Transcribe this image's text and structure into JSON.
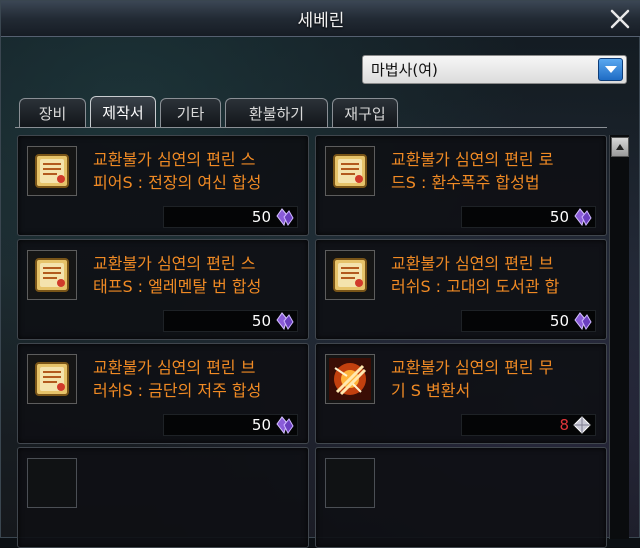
{
  "window": {
    "title": "세베린"
  },
  "class_select": {
    "value": "마법사(여)"
  },
  "tabs": [
    {
      "label": "장비",
      "active": false
    },
    {
      "label": "제작서",
      "active": true
    },
    {
      "label": "기타",
      "active": false
    },
    {
      "label": "환불하기",
      "active": false
    },
    {
      "label": "재구입",
      "active": false
    }
  ],
  "items": [
    {
      "line1": "교환불가 심연의 편린 스",
      "line2": "피어S : 전장의 여신 합성",
      "price": "50",
      "icon": "recipe-scroll-icon"
    },
    {
      "line1": "교환불가 심연의 편린 로",
      "line2": "드S : 환수폭주 합성법",
      "price": "50",
      "icon": "recipe-scroll-icon"
    },
    {
      "line1": "교환불가 심연의 편린 스",
      "line2": "태프S : 엘레멘탈 번 합성",
      "price": "50",
      "icon": "recipe-scroll-icon"
    },
    {
      "line1": "교환불가 심연의 편린 브",
      "line2": "러쉬S : 고대의 도서관 합",
      "price": "50",
      "icon": "recipe-scroll-icon"
    },
    {
      "line1": "교환불가 심연의 편린 브",
      "line2": "러쉬S : 금단의 저주 합성",
      "price": "50",
      "icon": "recipe-scroll-icon"
    },
    {
      "line1": "교환불가 심연의 편린 무",
      "line2": "기 S 변환서",
      "price": "8",
      "icon": "weapon-converter-icon"
    }
  ],
  "colors": {
    "item_name": "#f08a24",
    "price_insufficient": "#e0353a",
    "currency": "#8a5cd8"
  },
  "currency_icon": "abyss-shard-gem-icon"
}
